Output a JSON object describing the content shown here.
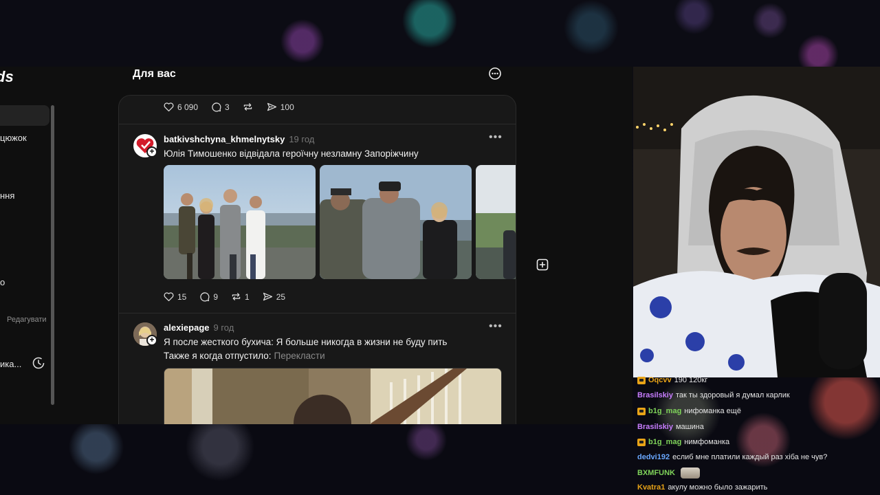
{
  "app": {
    "logo": "ds",
    "page_title": "Для вас"
  },
  "sidebar": {
    "items": [
      {
        "label": ""
      },
      {
        "label": "цюжок"
      },
      {
        "label": "ння"
      },
      {
        "label": "о"
      },
      {
        "label": "ика..."
      }
    ],
    "edit_label": "Редагувати"
  },
  "prev_post": {
    "likes": "6 090",
    "comments": "3",
    "reposts": "",
    "shares": "100"
  },
  "post1": {
    "username": "batkivshchyna_khmelnytsky",
    "time": "19 год",
    "text": "Юлія Тимошенко відвідала героїчну незламну Запоріжчину",
    "likes": "15",
    "comments": "9",
    "reposts": "1",
    "shares": "25"
  },
  "post2": {
    "username": "alexiepage",
    "time": "9 год",
    "text_line1": "Я после жесткого бухича: Я больше никогда в жизни не буду пить",
    "text_line2": "Также я когда отпустило:",
    "translate": "Перекласти"
  },
  "chat": {
    "messages": [
      {
        "user": "Оqсvv",
        "text": "190 120кг",
        "color": "#e8a317",
        "badge": true,
        "emote": false
      },
      {
        "user": "Brasilskiy",
        "text": "так ты здоровый я думал карлик",
        "color": "#c77dff",
        "badge": false,
        "emote": false
      },
      {
        "user": "b1g_mag",
        "text": "нифоманка ещё",
        "color": "#7fd35a",
        "badge": true,
        "emote": false
      },
      {
        "user": "Brasilskiy",
        "text": "машина",
        "color": "#c77dff",
        "badge": false,
        "emote": false
      },
      {
        "user": "b1g_mag",
        "text": "нимфоманка",
        "color": "#7fd35a",
        "badge": true,
        "emote": false
      },
      {
        "user": "dedvi192",
        "text": "еслиб мне платили каждый раз хіба не чув?",
        "color": "#6aa8ff",
        "badge": false,
        "emote": false
      },
      {
        "user": "BXMFUNK",
        "text": "",
        "color": "#7fd35a",
        "badge": false,
        "emote": true
      },
      {
        "user": "Kvatra1",
        "text": "акулу можно было зажарить",
        "color": "#e8a317",
        "badge": false,
        "emote": false
      }
    ]
  },
  "colors": {
    "feed_bg": "#181818",
    "page_bg": "#0f0f0f",
    "text": "#f3f3f3",
    "muted": "#777777"
  }
}
